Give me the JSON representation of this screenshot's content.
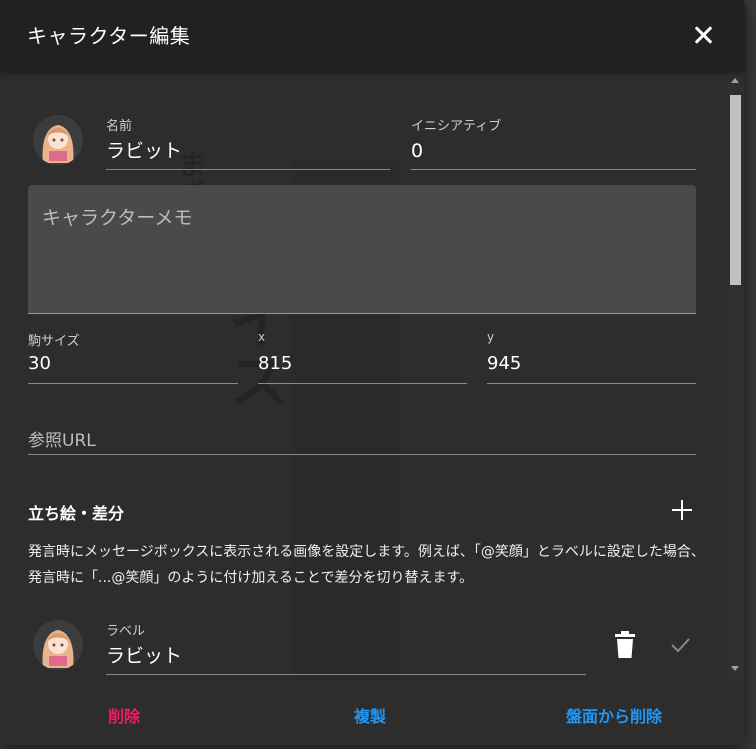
{
  "dialog": {
    "title": "キャラクター編集",
    "close_icon": "close-icon"
  },
  "character": {
    "name_label": "名前",
    "name_value": "ラビット",
    "initiative_label": "イニシアティブ",
    "initiative_value": "0",
    "memo_placeholder": "キャラクターメモ",
    "size_label": "駒サイズ",
    "size_value": "30",
    "x_label": "x",
    "x_value": "815",
    "y_label": "y",
    "y_value": "945",
    "url_placeholder": "参照URL"
  },
  "standing": {
    "section_title": "立ち絵・差分",
    "add_icon": "plus-icon",
    "description": "発言時にメッセージボックスに表示される画像を設定します。例えば、「@笑顔」とラベルに設定した場合、発言時に「...@笑顔」のように付け加えることで差分を切り替えます。",
    "items": [
      {
        "label_caption": "ラベル",
        "label_value": "ラビット"
      }
    ]
  },
  "actions": {
    "delete": "削除",
    "duplicate": "複製",
    "remove_from_board": "盤面から削除"
  },
  "colors": {
    "delete": "#e91e63",
    "primary": "#2196f3",
    "titlebar": "#212121",
    "dialog_bg": "#2d2d2d"
  }
}
